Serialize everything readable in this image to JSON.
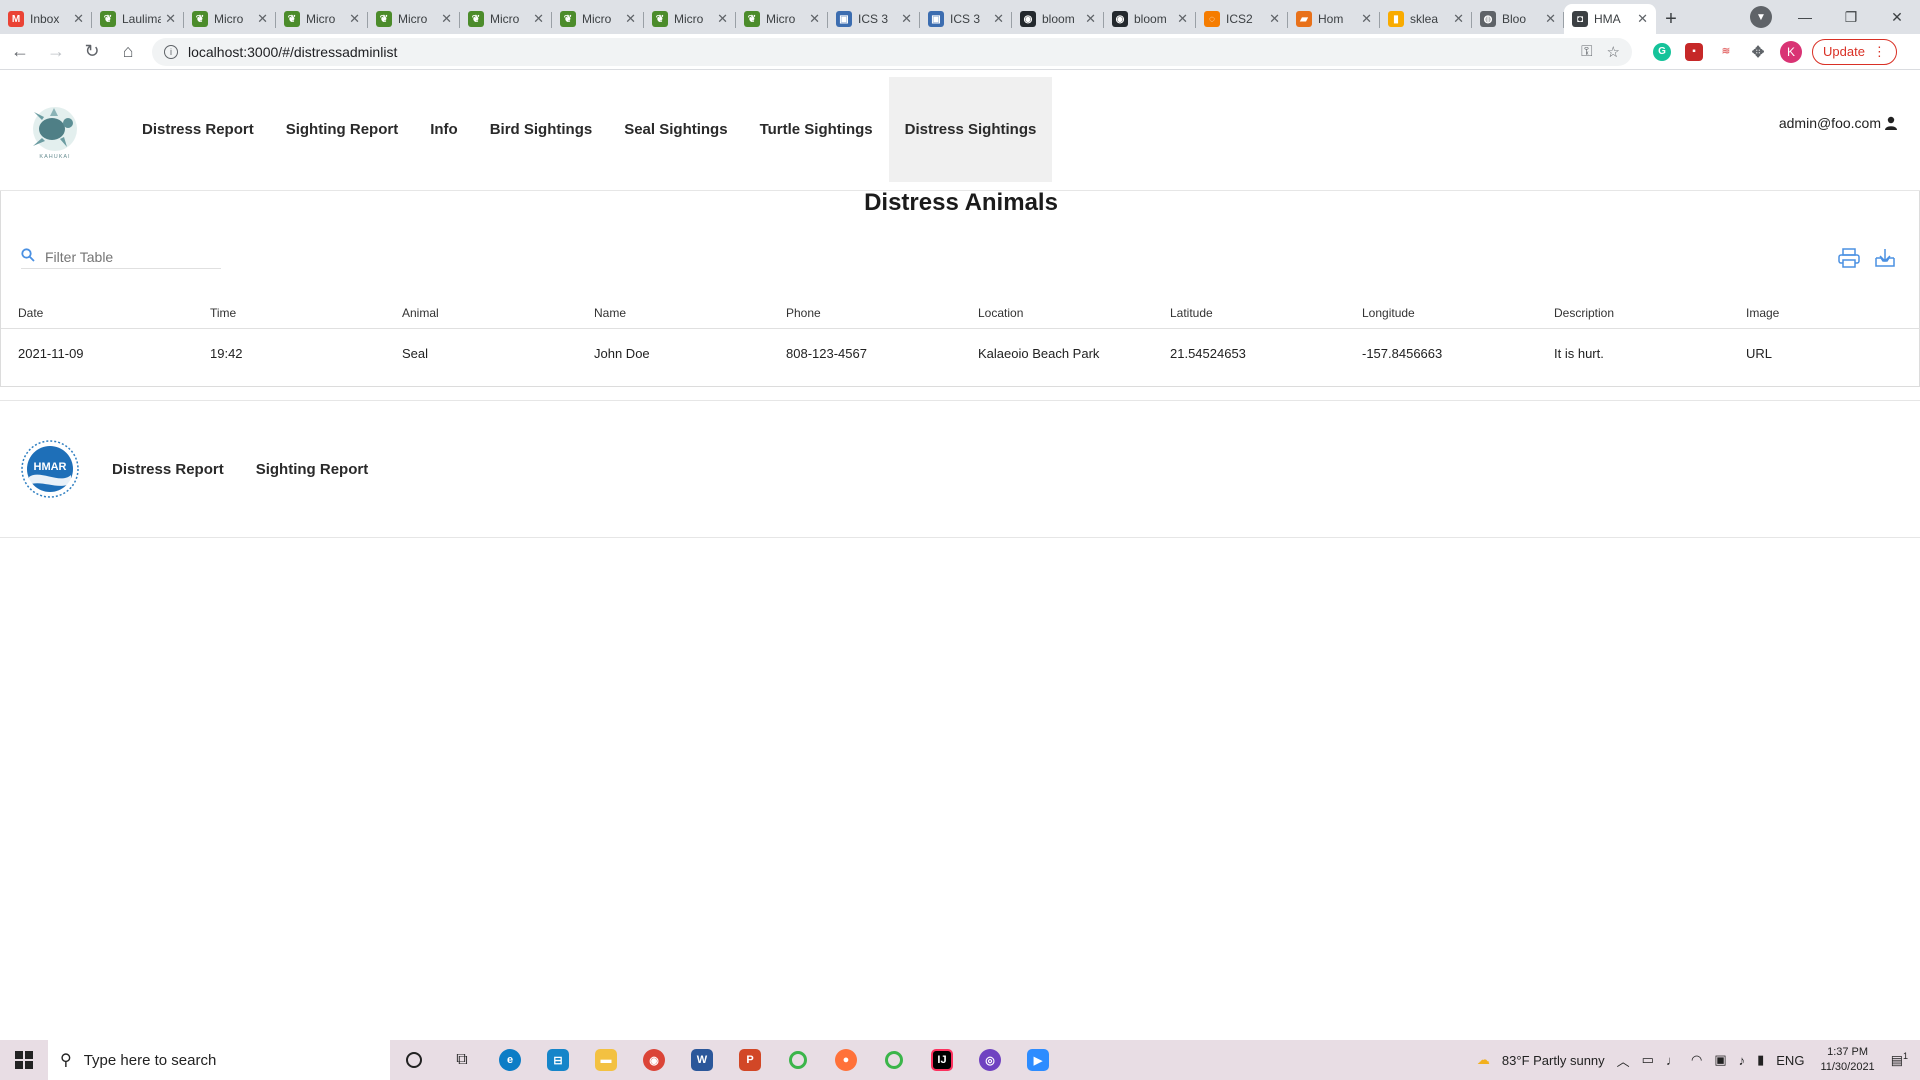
{
  "browser": {
    "tabs": [
      {
        "title": "Inbox",
        "color": "#ea4335",
        "glyph": "M"
      },
      {
        "title": "Laulima",
        "color": "#4c8c2b",
        "glyph": "❦"
      },
      {
        "title": "Micro",
        "color": "#4c8c2b",
        "glyph": "❦"
      },
      {
        "title": "Micro",
        "color": "#4c8c2b",
        "glyph": "❦"
      },
      {
        "title": "Micro",
        "color": "#4c8c2b",
        "glyph": "❦"
      },
      {
        "title": "Micro",
        "color": "#4c8c2b",
        "glyph": "❦"
      },
      {
        "title": "Micro",
        "color": "#4c8c2b",
        "glyph": "❦"
      },
      {
        "title": "Micro",
        "color": "#4c8c2b",
        "glyph": "❦"
      },
      {
        "title": "Micro",
        "color": "#4c8c2b",
        "glyph": "❦"
      },
      {
        "title": "ICS 3",
        "color": "#3c6db0",
        "glyph": "▣"
      },
      {
        "title": "ICS 3",
        "color": "#3c6db0",
        "glyph": "▣"
      },
      {
        "title": "bloom",
        "color": "#24292e",
        "glyph": "◉"
      },
      {
        "title": "bloom",
        "color": "#24292e",
        "glyph": "◉"
      },
      {
        "title": "ICS2",
        "color": "#f57c00",
        "glyph": "◌"
      },
      {
        "title": "Hom",
        "color": "#e8711a",
        "glyph": "▰"
      },
      {
        "title": "sklea",
        "color": "#f9ab00",
        "glyph": "▮"
      },
      {
        "title": "Bloo",
        "color": "#5f6368",
        "glyph": "◍"
      },
      {
        "title": "HMA",
        "color": "#3c4043",
        "glyph": "◘",
        "active": true
      }
    ],
    "url": "localhost:3000/#/distressadminlist",
    "update_label": "Update",
    "profile_letter": "K"
  },
  "nav": {
    "items": [
      "Distress Report",
      "Sighting Report",
      "Info",
      "Bird Sightings",
      "Seal Sightings",
      "Turtle Sightings",
      "Distress Sightings"
    ],
    "active_index": 6,
    "user": "admin@foo.com"
  },
  "main": {
    "title": "Distress Animals",
    "filter_placeholder": "Filter Table",
    "columns": [
      "Date",
      "Time",
      "Animal",
      "Name",
      "Phone",
      "Location",
      "Latitude",
      "Longitude",
      "Description",
      "Image"
    ],
    "rows": [
      [
        "2021-11-09",
        "19:42",
        "Seal",
        "John Doe",
        "808-123-4567",
        "Kalaeoio Beach Park",
        "21.54524653",
        "-157.8456663",
        "It is hurt.",
        "URL"
      ]
    ]
  },
  "footer": {
    "logo_text": "HMAR",
    "links": [
      "Distress Report",
      "Sighting Report"
    ]
  },
  "taskbar": {
    "search_placeholder": "Type here to search",
    "weather": "83°F  Partly sunny",
    "language": "ENG",
    "time": "1:37 PM",
    "date": "11/30/2021",
    "notification_count": "1"
  },
  "colors": {
    "accent_blue": "#4a90e2",
    "active_nav_bg": "#f0f0f0",
    "taskbar_bg": "#e8dde4"
  }
}
